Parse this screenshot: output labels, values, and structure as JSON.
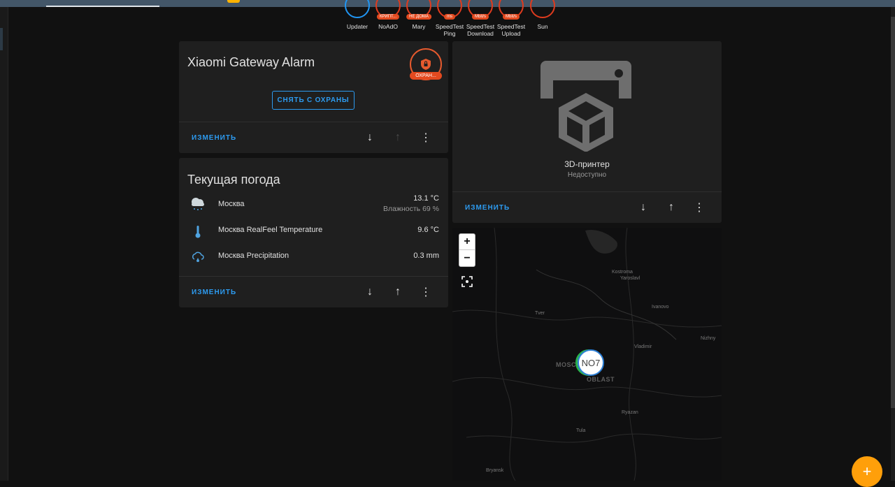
{
  "badges": [
    {
      "name": "Updater",
      "tag": ""
    },
    {
      "name": "NoAdO",
      "tag": "КРИПТ..."
    },
    {
      "name": "Mary",
      "tag": "НЕ ДОМА"
    },
    {
      "name": "SpeedTest Ping",
      "tag": "ms"
    },
    {
      "name": "SpeedTest Download",
      "tag": "Mbit/s"
    },
    {
      "name": "SpeedTest Upload",
      "tag": "Mbit/s"
    },
    {
      "name": "Sun",
      "tag": ""
    }
  ],
  "alarm_card": {
    "title": "Xiaomi Gateway Alarm",
    "state_tag": "ОХРАН...",
    "disarm_label": "СНЯТЬ С ОХРАНЫ",
    "edit_label": "ИЗМЕНИТЬ"
  },
  "weather_card": {
    "title": "Текущая погода",
    "rows": [
      {
        "name": "Москва",
        "value": "13.1 °C",
        "sub": "Влажность 69 %",
        "icon": "weather-rainy-cloud-icon"
      },
      {
        "name": "Москва RealFeel Temperature",
        "value": "9.6 °C",
        "icon": "thermometer-icon"
      },
      {
        "name": "Москва Precipitation",
        "value": "0.3 mm",
        "icon": "precipitation-cloud-icon"
      }
    ],
    "edit_label": "ИЗМЕНИТЬ"
  },
  "printer_card": {
    "name": "3D-принтер",
    "state": "Недоступно",
    "icon": "printer-3d-icon",
    "edit_label": "ИЗМЕНИТЬ"
  },
  "map_card": {
    "zoom_in": "+",
    "zoom_out": "−",
    "labels": {
      "kostroma": "Kostroma",
      "yaroslavl": "Yaroslavl",
      "ivanovo": "Ivanovo",
      "tver": "Tver",
      "vladimir": "Vladimir",
      "nizhny": "Nizhny",
      "moscow": "MOSCOW",
      "oblast": "OBLAST",
      "ryazan": "Ryazan",
      "tula": "Tula",
      "bryansk": "Bryansk"
    },
    "marker": "NO7"
  },
  "fab": {
    "label": "+"
  },
  "colors": {
    "accent": "#2d9bf0",
    "alarm": "#e65a2e",
    "fab": "#ff9f0a"
  }
}
